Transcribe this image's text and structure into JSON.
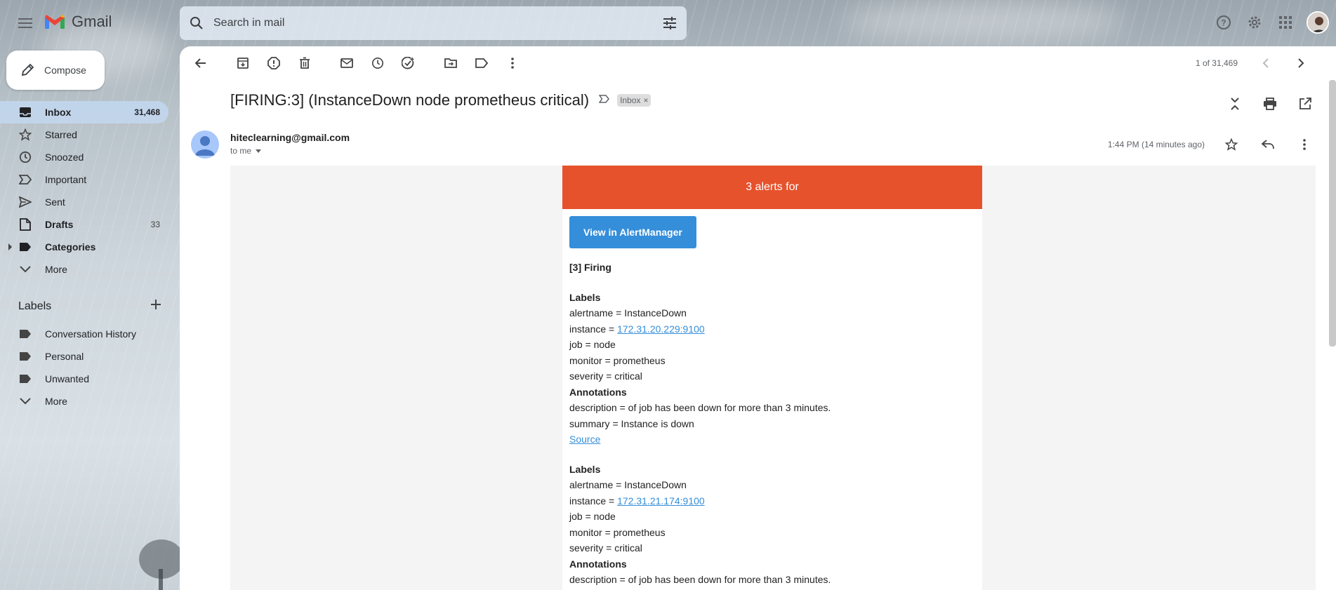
{
  "app": {
    "name": "Gmail"
  },
  "search": {
    "placeholder": "Search in mail"
  },
  "sidebar": {
    "compose_label": "Compose",
    "items": [
      {
        "label": "Inbox",
        "count": "31,468"
      },
      {
        "label": "Starred",
        "count": ""
      },
      {
        "label": "Snoozed",
        "count": ""
      },
      {
        "label": "Important",
        "count": ""
      },
      {
        "label": "Sent",
        "count": ""
      },
      {
        "label": "Drafts",
        "count": "33"
      },
      {
        "label": "Categories",
        "count": ""
      },
      {
        "label": "More",
        "count": ""
      }
    ],
    "labels_title": "Labels",
    "labels": [
      {
        "label": "Conversation History"
      },
      {
        "label": "Personal"
      },
      {
        "label": "Unwanted"
      },
      {
        "label": "More"
      }
    ]
  },
  "toolbar": {
    "pager": "1 of 31,469"
  },
  "email": {
    "subject": "[FIRING:3] (InstanceDown node prometheus critical)",
    "chip": "Inbox",
    "chip_close": "×",
    "sender": "hiteclearning@gmail.com",
    "to": "to me",
    "time": "1:44 PM (14 minutes ago)"
  },
  "alert": {
    "header": "3 alerts for",
    "button": "View in AlertManager",
    "firing": "[3] Firing",
    "alerts": [
      {
        "labels_title": "Labels",
        "alertname": "alertname = InstanceDown",
        "instance_prefix": "instance = ",
        "instance": "172.31.20.229:9100",
        "job": "job = node",
        "monitor": "monitor = prometheus",
        "severity": "severity = critical",
        "annotations_title": "Annotations",
        "description": "description = of job has been down for more than 3 minutes.",
        "summary": "summary = Instance is down",
        "source": "Source"
      },
      {
        "labels_title": "Labels",
        "alertname": "alertname = InstanceDown",
        "instance_prefix": "instance = ",
        "instance": "172.31.21.174:9100",
        "job": "job = node",
        "monitor": "monitor = prometheus",
        "severity": "severity = critical",
        "annotations_title": "Annotations",
        "description": "description = of job has been down for more than 3 minutes."
      }
    ]
  },
  "colors": {
    "alert_header": "#e6522c",
    "button": "#348eda",
    "active_nav": "#c2d7f0"
  }
}
